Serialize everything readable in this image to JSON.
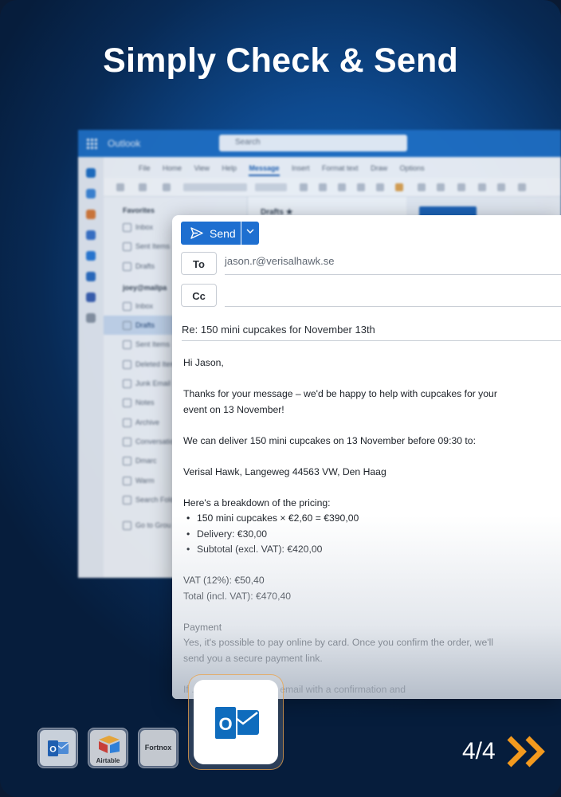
{
  "headline": "Simply Check & Send",
  "background_outlook": {
    "app_name": "Outlook",
    "search_placeholder": "Search",
    "menu": [
      "File",
      "Home",
      "View",
      "Help",
      "Message",
      "Insert",
      "Format text",
      "Draw",
      "Options"
    ],
    "menu_active": "Message",
    "favorites_label": "Favorites",
    "favorites": [
      "Inbox",
      "Sent Items",
      "Drafts"
    ],
    "account_label": "joey@mailpa",
    "folders": [
      "Inbox",
      "Drafts",
      "Sent Items",
      "Deleted Items",
      "Junk Email",
      "Notes",
      "Archive",
      "Conversation",
      "Dmarc",
      "Warm",
      "Search Fold"
    ],
    "selected_folder": "Drafts",
    "goto_groups": "Go to Grou",
    "list_header": "Drafts ★"
  },
  "compose": {
    "send_label": "Send",
    "to_label": "To",
    "cc_label": "Cc",
    "to_value": "jason.r@verisalhawk.se",
    "subject": "Re: 150 mini cupcakes for November 13th",
    "body": {
      "greeting": "Hi Jason,",
      "intro_1": "Thanks for your message – we'd be happy to help with cupcakes for your",
      "intro_2": "event on 13 November!",
      "delivery": "We can deliver 150 mini cupcakes on 13 November before 09:30 to:",
      "address": "Verisal Hawk, Langeweg 44563 VW, Den Haag",
      "breakdown_label": "Here's a breakdown of the pricing:",
      "items": [
        "150 mini cupcakes × €2,60 = €390,00",
        "Delivery: €30,00",
        "Subtotal (excl. VAT): €420,00"
      ],
      "vat": "VAT (12%): €50,40",
      "total": "Total (incl. VAT): €470,40",
      "payment_label": "Payment",
      "payment_1": "Yes, it's possible to pay online by card. Once you confirm the order, we'll",
      "payment_2": "send you a secure payment link.",
      "closing_partial": "If ... l, just reply to this email with a confirmation and"
    }
  },
  "dock": {
    "tiles": [
      "Outlook",
      "Airtable",
      "Fortnox"
    ],
    "airtable_label": "Airtable",
    "fortnox_label": "Fortnox",
    "active": "Outlook"
  },
  "pager": "4/4",
  "colors": {
    "brand_blue": "#1e6fd0",
    "accent_orange": "#f39a1e",
    "outlook_blue": "#0f6cbd"
  }
}
